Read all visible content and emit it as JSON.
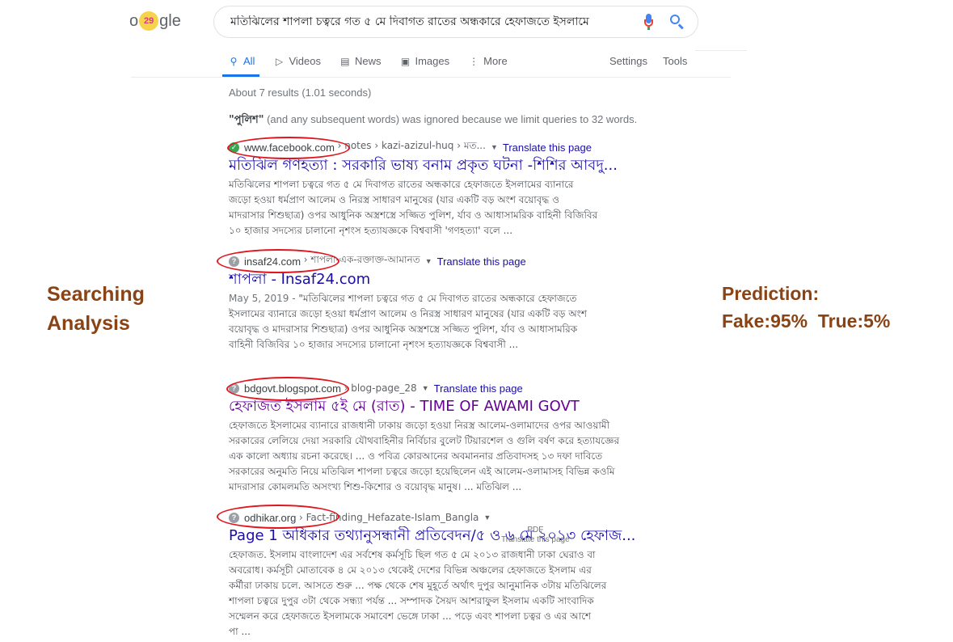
{
  "logo": {
    "text_left": "o",
    "doodle": "29",
    "text_right": "gle"
  },
  "search": {
    "query": "মতিঝিলের শাপলা চত্বরে গত ৫ মে দিবাগত রাতের অন্ধকারে হেফাজতে ইসলামে"
  },
  "tabs": [
    {
      "label": "All",
      "icon": "search-icon"
    },
    {
      "label": "Videos",
      "icon": "video-icon"
    },
    {
      "label": "News",
      "icon": "news-icon"
    },
    {
      "label": "Images",
      "icon": "image-icon"
    },
    {
      "label": "More",
      "icon": "more-vert-icon"
    }
  ],
  "tools": {
    "settings": "Settings",
    "tools": "Tools"
  },
  "stats": "About 7 results (1.01 seconds)",
  "notice": {
    "word": "\"পুলিশ\"",
    "rest": " (and any subsequent words) was ignored because we limit queries to 32 words."
  },
  "results": [
    {
      "domain": "www.facebook.com",
      "path": "› notes › kazi-azizul-huq › মত...",
      "translate": "Translate this page",
      "title": "মতিঝিল গণহত্যা : সরকারি ভাষ্য বনাম প্রকৃত ঘটনা -শিশির আবদু...",
      "snippet": [
        "মতিঝিলের শাপলা চত্বরে গত ৫ মে দিবাগত রাতের অন্ধকারে হেফাজতে ইসলামের ব্যানারে",
        "জড়ো হওয়া ধর্মপ্রাণ আলেম ও নিরস্ত্র সাধারণ মানুষের (যার একটি বড় অংশ বয়োবৃদ্ধ ও",
        "মাদরাসার শিশুছাত্র) ওপর আধুনিক অস্ত্রশস্ত্রে সজ্জিত পুলিশ, র্যাব ও আধাসামরিক বাহিনী বিজিবির",
        "১০ হাজার সদস্যের চালানো নৃশংস হত্যাযজ্ঞকে বিশ্ববাসী 'গণহত্যা' বলে ..."
      ]
    },
    {
      "domain": "insaf24.com",
      "path": "› শাপলা-এক-রক্তাক্ত-আমানত",
      "translate": "Translate this page",
      "title": "শাপলা - Insaf24.com",
      "date": "May 5, 2019 -",
      "snippet": [
        "\"মতিঝিলের শাপলা চত্বরে গত ৫ মে দিবাগত রাতের অন্ধকারে হেফাজতে",
        "ইসলামের ব্যানারে জড়ো হওয়া ধর্মপ্রাণ আলেম ও নিরস্ত্র সাধারণ মানুষের (যার একটি বড় অংশ",
        "বয়োবৃদ্ধ ও মাদরাসার শিশুছাত্র) ওপর আধুনিক অস্ত্রশস্ত্রে সজ্জিত পুলিশ, র্যাব ও আধাসামরিক",
        "বাহিনী বিজিবির ১০ হাজার সদস্যের চালানো নৃশংস হত্যাযজ্ঞকে বিশ্ববাসী ..."
      ]
    },
    {
      "domain": "bdgovt.blogspot.com",
      "path": "› blog-page_28",
      "translate": "Translate this page",
      "title": "হেফাজত ইসলাম ৫ই মে (রাত) - TIME OF AWAMI GOVT",
      "snippet": [
        "হেফাজতে ইসলামের ব্যানারে রাজধানী ঢাকায় জড়ো হওয়া নিরস্ত্র আলেম-ওলামাদের ওপর আওয়ামী",
        "সরকারের লেলিয়ে দেয়া সরকারি যৌথবাহিনীর নির্বিচার বুলেট টিয়ারশেল ও গুলি বর্ষণ করে হত্যাযজ্ঞের",
        "এক কালো অধ্যায় রচনা করেছে। ... ও পবিত্র কোরআনের অবমাননার প্রতিবাদসহ ১৩ দফা দাবিতে",
        "সরকারের অনুমতি নিয়ে মতিঝিল শাপলা চত্বরে জড়ো হয়েছিলেন এই আলেম-ওলামাসহ বিভিন্ন কওমি",
        "মাদরাসার কোমলমতি অসংখ্য শিশু-কিশোর ও বয়োবৃদ্ধ মানুষ। ... মতিঝিল ..."
      ]
    },
    {
      "domain": "odhikar.org",
      "path": "› Fact-finding_Hefazate-Islam_Bangla",
      "title": "Page 1 অধিকার তথ্যানুসন্ধানী প্রতিবেদন/৫ ও ৬ মে ২০১৩ হেফাজ...",
      "pdf": "PDF",
      "translate": "Translate this page",
      "snippet": [
        "হেফাজত. ইসলাম বাংলাদেশ এর সর্বশেষ কর্মসূচি ছিল গত ৫ মে ২০১৩ রাজধানী ঢাকা ঘেরাও বা",
        "অবরোধ। কর্মসূচী মোতাবেক ৪ মে ২০১৩ থেকেই দেশের বিভিন্ন অঞ্চলের হেফাজতে ইসলাম এর",
        "কর্মীরা ঢাকায় চলে. আসতে শুরু ... পক্ষ থেকে শেষ মুহূর্তে অর্থাৎ দুপুর আনুমানিক ৩টায় মতিঝিলের",
        "শাপলা চত্বরে দুপুর ৩টা থেকে সন্ধ্যা পর্যন্ত ... সম্পাদক সৈয়দ আশরাফুল ইসলাম একটি সাংবাদিক",
        "সম্মেলন করে হেফাজতে ইসলামকে সমাবেশ ভেঙ্গে ঢাকা ... পড়ে এবং শাপলা চত্বর ও এর আশে",
        "পা ..."
      ]
    }
  ],
  "annotation_left": [
    "Searching",
    "Analysis"
  ],
  "annotation_right": [
    "Prediction:",
    "Fake:95%  True:5%"
  ],
  "colors": {
    "link": "#1a0dab",
    "visited": "#660099",
    "accent": "#1a73e8",
    "annotation": "#8a4315",
    "circle": "#e0151e"
  }
}
